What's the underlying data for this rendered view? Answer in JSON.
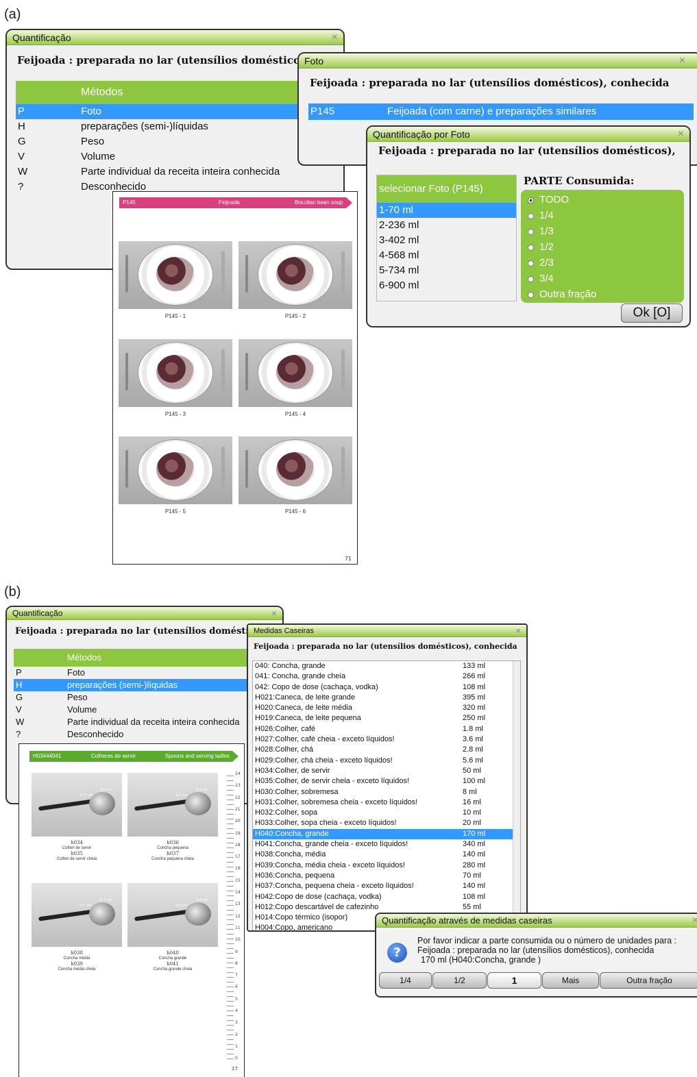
{
  "panel_a": {
    "label": "(a)",
    "quant": {
      "title": "Quantificação",
      "close": "×",
      "food": "Feijoada : preparada no lar (utensílios domésticos),",
      "methods_header": "Métodos",
      "methods": [
        {
          "key": "P",
          "label": "Foto",
          "selected": true
        },
        {
          "key": "H",
          "label": "preparações (semi-)líquidas",
          "selected": false
        },
        {
          "key": "G",
          "label": "Peso",
          "selected": false
        },
        {
          "key": "V",
          "label": "Volume",
          "selected": false
        },
        {
          "key": "W",
          "label": "Parte individual da receita inteira conhecida",
          "selected": false
        },
        {
          "key": "?",
          "label": "Desconhecido",
          "selected": false
        }
      ]
    },
    "foto": {
      "title": "Foto",
      "close": "×",
      "food": "Feijoada : preparada no lar (utensílios domésticos), conhecida",
      "code": "P145",
      "desc": "Feijoada (com carne) e preparações similares"
    },
    "qpf": {
      "title": "Quantificação por Foto",
      "close": "×",
      "food": "Feijoada : preparada no lar (utensílios domésticos),",
      "list_header": "selecionar Foto (P145)",
      "portions": [
        "1-70 ml",
        "2-236 ml",
        "3-402 ml",
        "4-568 ml",
        "5-734 ml",
        "6-900 ml"
      ],
      "parte_label": "PARTE Consumida:",
      "parts": [
        "TODO",
        "1/4",
        "1/3",
        "1/2",
        "2/3",
        "3/4",
        "Outra fração"
      ],
      "ok": "Ok [O]"
    },
    "album": {
      "code": "P145",
      "name": "Feijoada",
      "english": "Brazilian bean soup",
      "captions": [
        "P145 - 1",
        "P145 - 2",
        "P145 - 3",
        "P145 - 4",
        "P145 - 5",
        "P145 - 6"
      ],
      "page_no": "71"
    }
  },
  "panel_b": {
    "label": "(b)",
    "quant": {
      "title": "Quantificação",
      "close": "×",
      "food": "Feijoada : preparada no lar (utensílios domésticos),",
      "methods_header": "Métodos",
      "methods": [
        {
          "key": "P",
          "label": "Foto",
          "selected": false
        },
        {
          "key": "H",
          "label": "preparações (semi-)líquidas",
          "selected": true
        },
        {
          "key": "G",
          "label": "Peso",
          "selected": false
        },
        {
          "key": "V",
          "label": "Volume",
          "selected": false
        },
        {
          "key": "W",
          "label": "Parte individual da receita inteira conhecida",
          "selected": false
        },
        {
          "key": "?",
          "label": "Desconhecido",
          "selected": false
        }
      ]
    },
    "medidas": {
      "title": "Medidas Caseiras",
      "close": "×",
      "food": "Feijoada : preparada no lar (utensílios domésticos), conhecida",
      "rows": [
        {
          "name": "040: Concha, grande",
          "value": "133 ml"
        },
        {
          "name": "041: Concha, grande cheia",
          "value": "266 ml"
        },
        {
          "name": "042: Copo de dose (cachaça, vodka)",
          "value": "108 ml"
        },
        {
          "name": "H021:Caneca, de leite grande",
          "value": "395 ml"
        },
        {
          "name": "H020:Caneca, de leite média",
          "value": "320 ml"
        },
        {
          "name": "H019:Caneca, de leite pequena",
          "value": "250 ml"
        },
        {
          "name": "H026:Colher, café",
          "value": "1.8 ml"
        },
        {
          "name": "H027:Colher, café cheia - exceto líquidos!",
          "value": "3.6 ml"
        },
        {
          "name": "H028:Colher, chá",
          "value": "2.8 ml"
        },
        {
          "name": "H029:Colher, chá cheia - exceto líquidos!",
          "value": "5.6 ml"
        },
        {
          "name": "H034:Colher, de servir",
          "value": "50 ml"
        },
        {
          "name": "H035:Colher, de servir cheia - exceto líquidos!",
          "value": "100 ml"
        },
        {
          "name": "H030:Colher, sobremesa",
          "value": "8 ml"
        },
        {
          "name": "H031:Colher, sobremesa cheia - exceto líquidos!",
          "value": "16 ml"
        },
        {
          "name": "H032:Colher, sopa",
          "value": "10 ml"
        },
        {
          "name": "H033:Colher, sopa cheia - exceto líquidos!",
          "value": "20 ml"
        },
        {
          "name": "H040:Concha, grande",
          "value": "170 ml",
          "selected": true
        },
        {
          "name": "H041:Concha, grande cheia - exceto líquidos!",
          "value": "340 ml"
        },
        {
          "name": "H038:Concha, média",
          "value": "140 ml"
        },
        {
          "name": "H039:Concha, média cheia - exceto líquidos!",
          "value": "280 ml"
        },
        {
          "name": "H036:Concha, pequena",
          "value": "70 ml"
        },
        {
          "name": "H037:Concha, pequena cheia - exceto líquidos!",
          "value": "140 ml"
        },
        {
          "name": "H042:Copo de dose (cachaça, vodka)",
          "value": "108 ml"
        },
        {
          "name": "H012:Copo descartável de cafezinho",
          "value": "55 ml"
        },
        {
          "name": "H014:Copo térmico (isopor)",
          "value": ""
        },
        {
          "name": "H004:Copo, americano",
          "value": ""
        }
      ]
    },
    "dialog": {
      "title": "Quantificação através de medidas caseiras",
      "close": "×",
      "icon": "?",
      "line1": "Por favor indicar a parte consumida ou o número de unidades para :",
      "line2": "Feijoada : preparada no lar (utensílios domésticos), conhecida",
      "line3": "170 ml (H040:Concha, grande )",
      "buttons": [
        "1/4",
        "1/2",
        "1",
        "Mais",
        "Outra fração"
      ]
    },
    "album": {
      "code": "H03444041",
      "name": "Colheres de servir",
      "english": "Spoons and serving ladles",
      "items": [
        {
          "a": "h034",
          "b": "Colher de servir",
          "c": "h035",
          "d": "Colher de servir cheia"
        },
        {
          "a": "h036",
          "b": "Concha pequena",
          "c": "h037",
          "d": "Concha pequena cheia"
        },
        {
          "a": "h038",
          "b": "Concha média",
          "c": "h039",
          "d": "Concha média cheia"
        },
        {
          "a": "h040",
          "b": "Concha grande",
          "c": "h041",
          "d": "Concha grande cheia"
        }
      ],
      "dims": [
        "10,5 cm",
        "5,6 cm",
        "3,1 cm",
        "8,2 cm",
        "6,7 cm",
        "6,7 cm",
        "9,0 cm",
        "9,0 cm"
      ],
      "ruler_nums": [
        "24",
        "23",
        "22",
        "21",
        "20",
        "19",
        "18",
        "17",
        "16",
        "15",
        "14",
        "13",
        "12",
        "11",
        "10",
        "9",
        "8",
        "7",
        "6",
        "5",
        "4",
        "3",
        "2",
        "1",
        "0"
      ],
      "page_no": "17"
    }
  },
  "colors": {
    "green": "#8dc63f",
    "select": "#3399ff",
    "pink": "#d9407f"
  }
}
